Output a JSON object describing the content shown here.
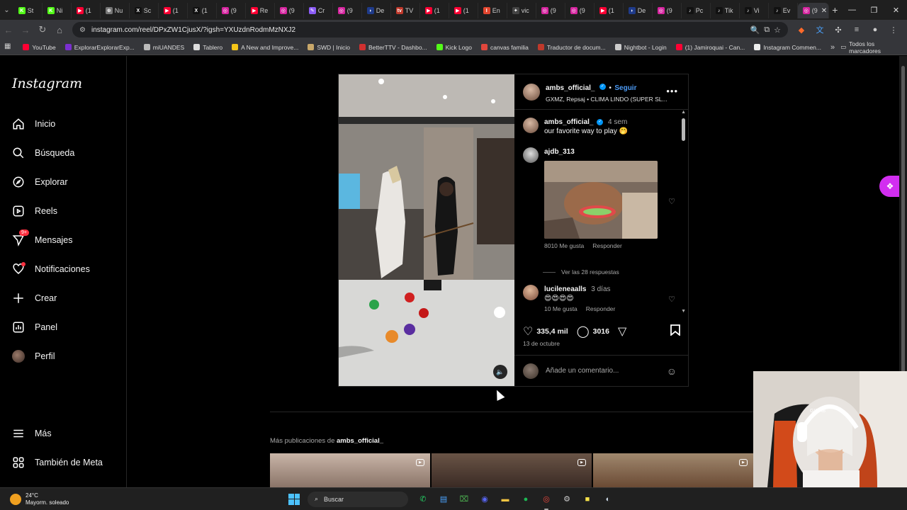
{
  "browser": {
    "tabs": [
      {
        "label": "St",
        "fav": "K",
        "color": "#53fc18"
      },
      {
        "label": "Ni",
        "fav": "K",
        "color": "#53fc18"
      },
      {
        "label": "(1",
        "fav": "▶",
        "color": "#ff0033"
      },
      {
        "label": "Nu",
        "fav": "⊕",
        "color": "#777"
      },
      {
        "label": "Sc",
        "fav": "X",
        "color": "#111"
      },
      {
        "label": "(1",
        "fav": "▶",
        "color": "#ff0033"
      },
      {
        "label": "(1",
        "fav": "X",
        "color": "#111"
      },
      {
        "label": "(9",
        "fav": "◎",
        "color": "#d6249f"
      },
      {
        "label": "Re",
        "fav": "▶",
        "color": "#ff0033"
      },
      {
        "label": "(9",
        "fav": "◎",
        "color": "#d6249f"
      },
      {
        "label": "Cr",
        "fav": "✎",
        "color": "#8b5cf6"
      },
      {
        "label": "(9",
        "fav": "◎",
        "color": "#d6249f"
      },
      {
        "label": "De",
        "fav": "◗",
        "color": "#1f3b8a"
      },
      {
        "label": "TV",
        "fav": "tv",
        "color": "#c0392b"
      },
      {
        "label": "(1",
        "fav": "▶",
        "color": "#ff0033"
      },
      {
        "label": "(1",
        "fav": "▶",
        "color": "#ff0033"
      },
      {
        "label": "En",
        "fav": "I",
        "color": "#e2462f"
      },
      {
        "label": "vic",
        "fav": "✦",
        "color": "#444"
      },
      {
        "label": "(9",
        "fav": "◎",
        "color": "#d6249f"
      },
      {
        "label": "(9",
        "fav": "◎",
        "color": "#d6249f"
      },
      {
        "label": "(1",
        "fav": "▶",
        "color": "#ff0033"
      },
      {
        "label": "De",
        "fav": "◗",
        "color": "#1f3b8a"
      },
      {
        "label": "(9",
        "fav": "◎",
        "color": "#d6249f"
      },
      {
        "label": "Pc",
        "fav": "♪",
        "color": "#111"
      },
      {
        "label": "Tik",
        "fav": "♪",
        "color": "#111"
      },
      {
        "label": "Vi",
        "fav": "♪",
        "color": "#111"
      },
      {
        "label": "Ev",
        "fav": "♪",
        "color": "#111"
      },
      {
        "label": "(9",
        "fav": "◎",
        "color": "#d6249f"
      }
    ],
    "url": "instagram.com/reel/DPxZW1CjusX/?igsh=YXUzdnRodmMzNXJ2",
    "bookmarks": [
      {
        "label": "YouTube",
        "color": "#ff0033"
      },
      {
        "label": "ExplorarExplorarExp...",
        "color": "#7b2fd0"
      },
      {
        "label": "miUANDES",
        "color": "#bbb"
      },
      {
        "label": "Tablero",
        "color": "#ddd"
      },
      {
        "label": "A New and Improve...",
        "color": "#f5c518"
      },
      {
        "label": "SWD | Inicio",
        "color": "#c9a86a"
      },
      {
        "label": "BetterTTV - Dashbo...",
        "color": "#d0302f"
      },
      {
        "label": "Kick Logo",
        "color": "#53fc18"
      },
      {
        "label": "canvas familia",
        "color": "#e0463c"
      },
      {
        "label": "Traductor de docum...",
        "color": "#c0392b"
      },
      {
        "label": "Nightbot - Login",
        "color": "#ccc"
      },
      {
        "label": "(1) Jamiroquai - Can...",
        "color": "#ff0033"
      },
      {
        "label": "Instagram Commen...",
        "color": "#eee"
      }
    ],
    "all_bookmarks": "Todos los marcadores"
  },
  "sidebar": {
    "logo": "Instagram",
    "items": [
      {
        "label": "Inicio",
        "icon": "home-icon"
      },
      {
        "label": "Búsqueda",
        "icon": "search-icon"
      },
      {
        "label": "Explorar",
        "icon": "compass-icon"
      },
      {
        "label": "Reels",
        "icon": "reels-icon"
      },
      {
        "label": "Mensajes",
        "icon": "messenger-icon",
        "badge": "9+"
      },
      {
        "label": "Notificaciones",
        "icon": "heart-icon"
      },
      {
        "label": "Crear",
        "icon": "plus-icon"
      },
      {
        "label": "Panel",
        "icon": "chart-icon"
      },
      {
        "label": "Perfil",
        "icon": "avatar"
      }
    ],
    "more": "Más",
    "meta": "También de Meta"
  },
  "post": {
    "username": "ambs_official_",
    "follow": "Seguir",
    "audio": "GXMZ, Repsaj • CLIMA LINDO (SUPER SL...",
    "caption_user": "ambs_official_",
    "caption_time": "4 sem",
    "caption": "our favorite way to play 🤭",
    "comments": [
      {
        "user": "ajdb_313",
        "likes": "8010 Me gusta",
        "reply": "Responder",
        "view_replies": "Ver las 28 respuestas"
      },
      {
        "user": "lucileneaalls",
        "time": "3 días",
        "text": "😍😍😍😍",
        "likes": "10 Me gusta",
        "reply": "Responder"
      }
    ],
    "like_count": "335,4 mil",
    "comment_count": "3016",
    "date": "13 de octubre",
    "add_comment_placeholder": "Añade un comentario..."
  },
  "more_posts": {
    "prefix": "Más publicaciones de",
    "user": "ambs_official_"
  },
  "taskbar": {
    "temp": "24°C",
    "weather": "Mayorm. soleado",
    "search": "Buscar"
  }
}
